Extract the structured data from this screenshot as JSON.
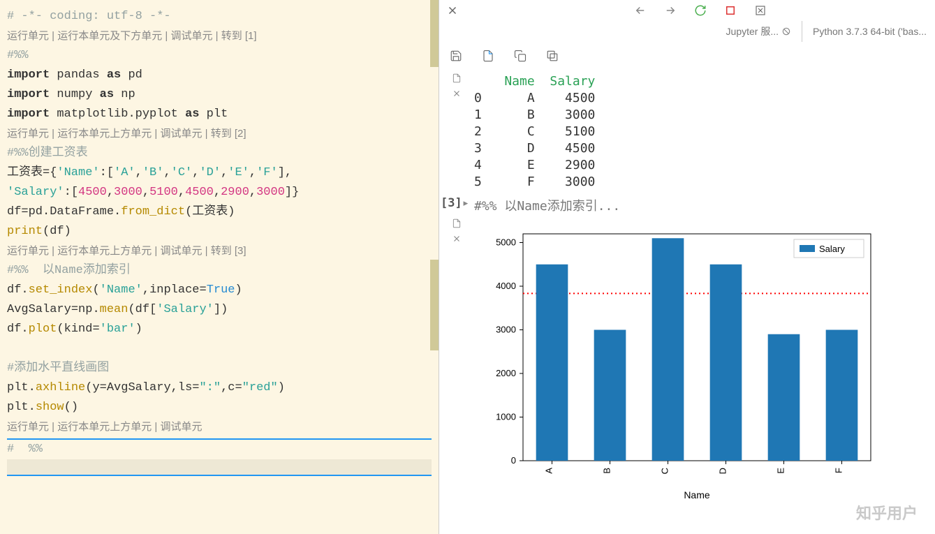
{
  "editor": {
    "encoding_comment": "# -*- coding: utf-8 -*-",
    "cell1_controls": "运行单元 | 运行本单元及下方单元 | 调试单元 | 转到 [1]",
    "cell1_marker": "#%%",
    "line_import1_kw1": "import",
    "line_import1_mod": "pandas",
    "line_import1_kw2": "as",
    "line_import1_alias": "pd",
    "line_import2_kw1": "import",
    "line_import2_mod": "numpy",
    "line_import2_kw2": "as",
    "line_import2_alias": "np",
    "line_import3_kw1": "import",
    "line_import3_mod": "matplotlib.pyplot",
    "line_import3_kw2": "as",
    "line_import3_alias": "plt",
    "cell2_controls": "运行单元 | 运行本单元上方单元 | 调试单元 | 转到 [2]",
    "cell2_marker": "#%%创建工资表",
    "dict_var": "工资表",
    "dict_eq": "=",
    "dict_open": "{",
    "dict_key1": "'Name'",
    "dict_colon": ":",
    "dict_list_open": "[",
    "names_a": "'A'",
    "names_b": "'B'",
    "names_c": "'C'",
    "names_d": "'D'",
    "names_e": "'E'",
    "names_f": "'F'",
    "dict_list_close": "]",
    "dict_comma": ",",
    "dict_key2": "'Salary'",
    "sal_1": "4500",
    "sal_2": "3000",
    "sal_3": "5100",
    "sal_4": "4500",
    "sal_5": "2900",
    "sal_6": "3000",
    "dict_close": "}",
    "df_assign": "df=pd.DataFrame.from_dict(工资表)",
    "df_var": "df",
    "df_eq": "=",
    "df_pd": "pd",
    "df_dot1": ".",
    "df_dataframe": "DataFrame",
    "df_dot2": ".",
    "df_fromdict": "from_dict",
    "df_paren_o": "(",
    "df_arg": "工资表",
    "df_paren_c": ")",
    "print_fn": "print",
    "print_po": "(",
    "print_arg": "df",
    "print_pc": ")",
    "cell3_controls": "运行单元 | 运行本单元上方单元 | 调试单元 | 转到 [3]",
    "cell3_marker": "#%%  以Name添加索引",
    "si_df": "df",
    "si_dot": ".",
    "si_fn": "set_index",
    "si_po": "(",
    "si_arg1": "'Name'",
    "si_comma": ",",
    "si_kw": "inplace",
    "si_eq": "=",
    "si_true": "True",
    "si_pc": ")",
    "avg_var": "AvgSalary",
    "avg_eq": "=",
    "avg_np": "np",
    "avg_dot": ".",
    "avg_mean": "mean",
    "avg_po": "(",
    "avg_df": "df",
    "avg_bo": "[",
    "avg_key": "'Salary'",
    "avg_bc": "]",
    "avg_pc": ")",
    "plot_df": "df",
    "plot_dot": ".",
    "plot_fn": "plot",
    "plot_po": "(",
    "plot_kw": "kind",
    "plot_eq": "=",
    "plot_val": "'bar'",
    "plot_pc": ")",
    "comment_hline": "#添加水平直线画图",
    "ax_plt": "plt",
    "ax_dot": ".",
    "ax_fn": "axhline",
    "ax_po": "(",
    "ax_y": "y",
    "ax_eq1": "=",
    "ax_yval": "AvgSalary",
    "ax_c1": ",",
    "ax_ls": "ls",
    "ax_eq2": "=",
    "ax_lsval": "\":\"",
    "ax_c2": ",",
    "ax_c": "c",
    "ax_eq3": "=",
    "ax_cval": "\"red\"",
    "ax_pc": ")",
    "show_plt": "plt",
    "show_dot": ".",
    "show_fn": "show",
    "show_po": "(",
    "show_pc": ")",
    "cell4_controls": "运行单元 | 运行本单元上方单元 | 调试单元",
    "cell4_marker": "#  %%"
  },
  "status": {
    "jupyter": "Jupyter 服...",
    "kernel": "Python 3.7.3 64-bit ('bas..."
  },
  "output": {
    "exec_label": "[3]",
    "df_text": "    Name  Salary\n0      A    4500\n1      B    3000\n2      C    5100\n3      D    4500\n4      E    2900\n5      F    3000",
    "df_header": "    Name  Salary",
    "df_row0": "0      A    4500",
    "df_row1": "1      B    3000",
    "df_row2": "2      C    5100",
    "df_row3": "3      D    4500",
    "df_row4": "4      E    2900",
    "df_row5": "5      F    3000",
    "cell_header": "#%%  以Name添加索引..."
  },
  "chart_data": {
    "type": "bar",
    "categories": [
      "A",
      "B",
      "C",
      "D",
      "E",
      "F"
    ],
    "values": [
      4500,
      3000,
      5100,
      4500,
      2900,
      3000
    ],
    "series_name": "Salary",
    "xlabel": "Name",
    "ylabel": "",
    "ylim": [
      0,
      5200
    ],
    "yticks": [
      0,
      1000,
      2000,
      3000,
      4000,
      5000
    ],
    "hline": {
      "y": 3833.33,
      "color": "red",
      "style": "dotted"
    },
    "legend": [
      "Salary"
    ],
    "bar_color": "#1f77b4"
  },
  "watermark": "知乎用户"
}
